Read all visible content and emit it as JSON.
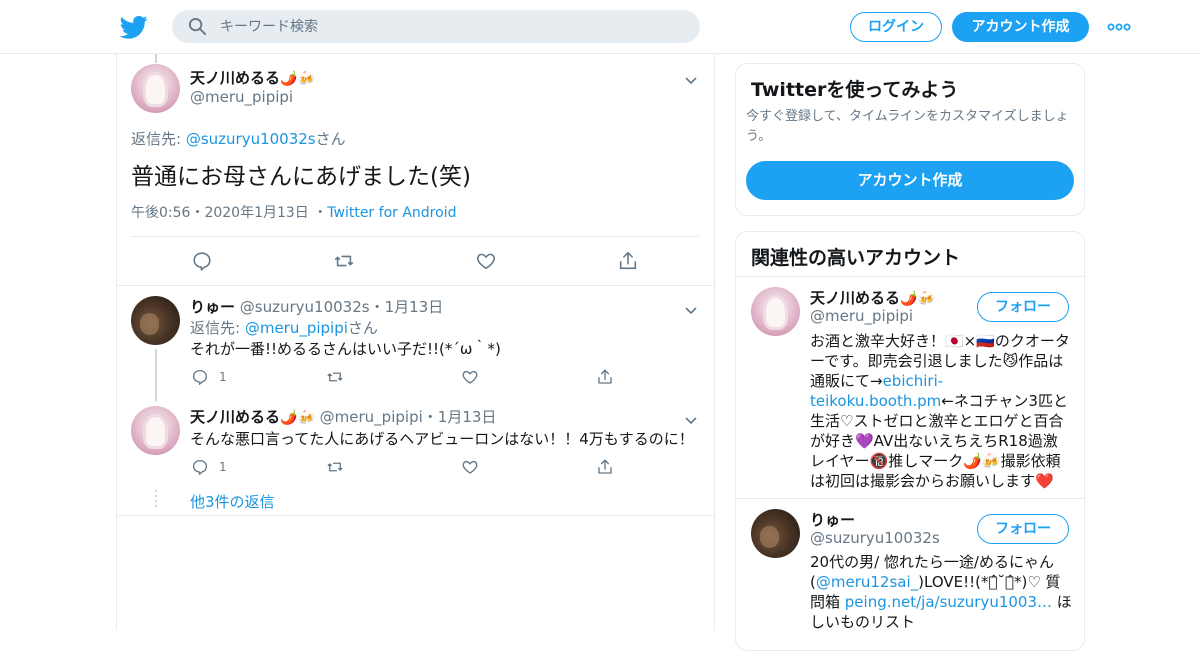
{
  "header": {
    "search_placeholder": "キーワード検索",
    "login_label": "ログイン",
    "signup_label": "アカウント作成"
  },
  "focal_tweet": {
    "name": "天ノ川めるる",
    "name_emoji": "🌶️🍻",
    "handle": "@meru_pipipi",
    "reply_prefix": "返信先: ",
    "reply_to": "@suzuryu10032s",
    "reply_suffix": "さん",
    "text": "普通にお母さんにあげました(笑)",
    "time": "午後0:56",
    "date": "2020年1月13日",
    "dot": "・",
    "source": "Twitter for Android"
  },
  "replies": [
    {
      "name": "りゅー",
      "handle": "@suzuryu10032s",
      "dot": "・",
      "date": "1月13日",
      "reply_prefix": "返信先: ",
      "reply_to": "@meru_pipipi",
      "reply_suffix": "さん",
      "text": "それが一番!!めるるさんはいい子だ!!(*´ω｀*)",
      "reply_count": "1"
    },
    {
      "name": "天ノ川めるる",
      "name_emoji": "🌶️🍻",
      "handle": "@meru_pipipi",
      "dot": "・",
      "date": "1月13日",
      "text": "そんな悪口言ってた人にあげるヘアビューロンはない！！4万もするのに！",
      "reply_count": "1"
    }
  ],
  "more_replies": "他3件の返信",
  "sidebar": {
    "try_card": {
      "title": "Twitterを使ってみよう",
      "subtitle": "今すぐ登録して、タイムラインをカスタマイズしましょう。",
      "button": "アカウント作成"
    },
    "related": {
      "title": "関連性の高いアカウント",
      "follow_label": "フォロー",
      "accounts": [
        {
          "name": "天ノ川めるる",
          "name_emoji": "🌶️🍻",
          "handle": "@meru_pipipi",
          "bio_1": "お酒と激辛大好き！🇯🇵×🇷🇺のクオーターです。即売会引退しました😼作品は通販にて→",
          "bio_link": "ebichiri-teikoku.booth.pm",
          "bio_2": "←ネコチャン3匹と生活♡ストゼロと激辛とエロゲと百合が好き💜AV出ないえちえちR18過激レイヤー🔞推しマーク🌶️🍻撮影依頼は初回は撮影会からお願いします❤️"
        },
        {
          "name": "りゅー",
          "handle": "@suzuryu10032s",
          "bio_1": "20代の男/ 惚れたら一途/めるにゃん(",
          "bio_link": "@meru12sai_",
          "bio_2": ")LOVE!!(*ฅ̂˘ฅ̂*)♡ 質問箱 ",
          "bio_link2": "peing.net/ja/suzuryu1003…",
          "bio_3": " ほしいものリスト"
        }
      ]
    }
  },
  "colors": {
    "accent": "#1da1f2",
    "link": "#1b95e0",
    "muted": "#657786",
    "border": "#e6ecf0"
  },
  "icons": [
    "twitter-bird-icon",
    "search-icon",
    "more-dots-icon",
    "chevron-down-icon",
    "reply-icon",
    "retweet-icon",
    "like-icon",
    "share-icon"
  ]
}
